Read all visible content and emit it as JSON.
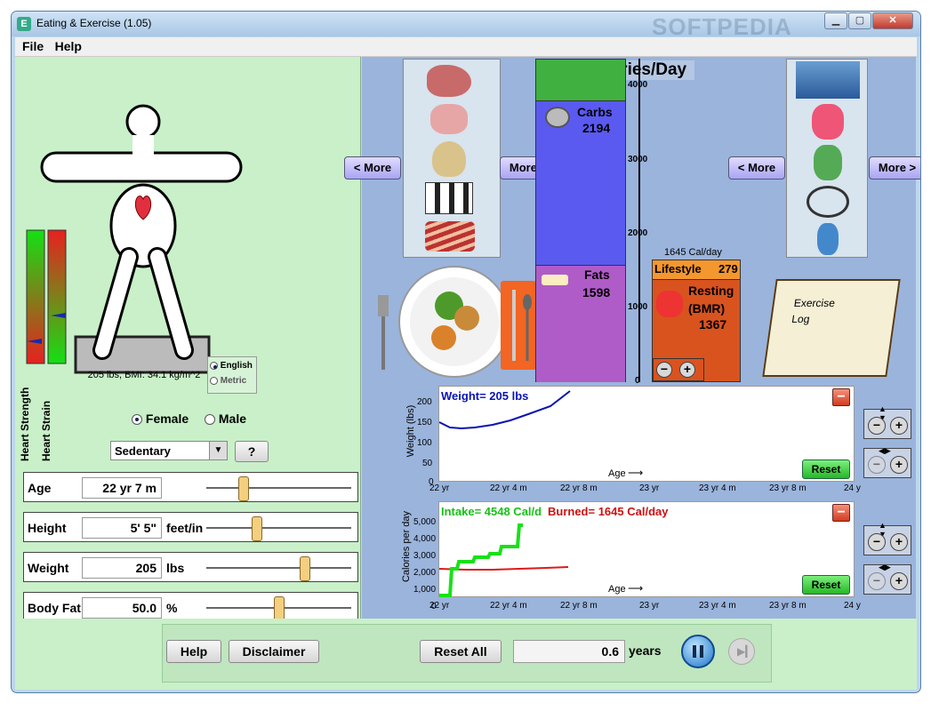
{
  "window": {
    "title": "Eating & Exercise (1.05)",
    "watermark": "SOFTPEDIA"
  },
  "menu": {
    "file": "File",
    "help": "Help"
  },
  "body": {
    "bmi_label": "205 lbs, BMI: 34.1 kg/m^2",
    "units": {
      "english": "English",
      "metric": "Metric"
    },
    "heart_strength": "Heart Strength",
    "heart_strain": "Heart Strain"
  },
  "gender": {
    "female": "Female",
    "male": "Male"
  },
  "activity": {
    "selected": "Sedentary",
    "help": "?"
  },
  "params": [
    {
      "label": "Age",
      "value": "22 yr 7 m",
      "unit": "",
      "level": 0.26
    },
    {
      "label": "Height",
      "value": "5' 5\"",
      "unit": "feet/in",
      "level": 0.35
    },
    {
      "label": "Weight",
      "value": "205",
      "unit": "lbs",
      "level": 0.68
    },
    {
      "label": "Body Fat",
      "value": "50.0",
      "unit": "%",
      "level": 0.5
    }
  ],
  "food": {
    "more_left": "< More",
    "more_right": "More >"
  },
  "exercise": {
    "more_left": "< More",
    "more_right": "More >",
    "log_line1": "Exercise",
    "log_line2": "Log"
  },
  "calories": {
    "title": "Calories/Day",
    "scale": [
      "4000",
      "3000",
      "2000",
      "1000",
      "0"
    ],
    "carbs_label": "Carbs",
    "carbs_value": "2194",
    "fats_label": "Fats",
    "fats_value": "1598",
    "burn_header": "1645 Cal/day",
    "lifestyle_label": "Lifestyle",
    "lifestyle_value": "279",
    "resting_line1": "Resting",
    "resting_line2": "(BMR)",
    "resting_value": "1367"
  },
  "weight_chart": {
    "legend": "Weight= 205 lbs",
    "ylabel": "Weight (lbs)",
    "age_label": "Age",
    "yticks": [
      "200",
      "150",
      "100",
      "50",
      "0"
    ],
    "xticks": [
      "22 yr",
      "22 yr 4 m",
      "22 yr 8 m",
      "23 yr",
      "23 yr 4 m",
      "23 yr 8 m",
      "24 y"
    ],
    "reset": "Reset"
  },
  "calorie_chart": {
    "legend_intake": "Intake= 4548 Cal/d",
    "legend_burned": "Burned= 1645 Cal/day",
    "ylabel": "Calories per day",
    "age_label": "Age",
    "yticks": [
      "5,000",
      "4,000",
      "3,000",
      "2,000",
      "1,000",
      "0"
    ],
    "xticks": [
      "22 yr",
      "22 yr 4 m",
      "22 yr 8 m",
      "23 yr",
      "23 yr 4 m",
      "23 yr 8 m",
      "24 y"
    ],
    "reset": "Reset"
  },
  "bottom": {
    "help": "Help",
    "disclaimer": "Disclaimer",
    "reset_all": "Reset All",
    "time_value": "0.6",
    "time_unit": "years"
  },
  "colors": {
    "carbs": "#5a5af0",
    "fats": "#b05cc8",
    "burn": "#d9531f",
    "weight_line": "#0a14b4",
    "intake_line": "#19e019",
    "burned_line": "#dd1a1a"
  }
}
